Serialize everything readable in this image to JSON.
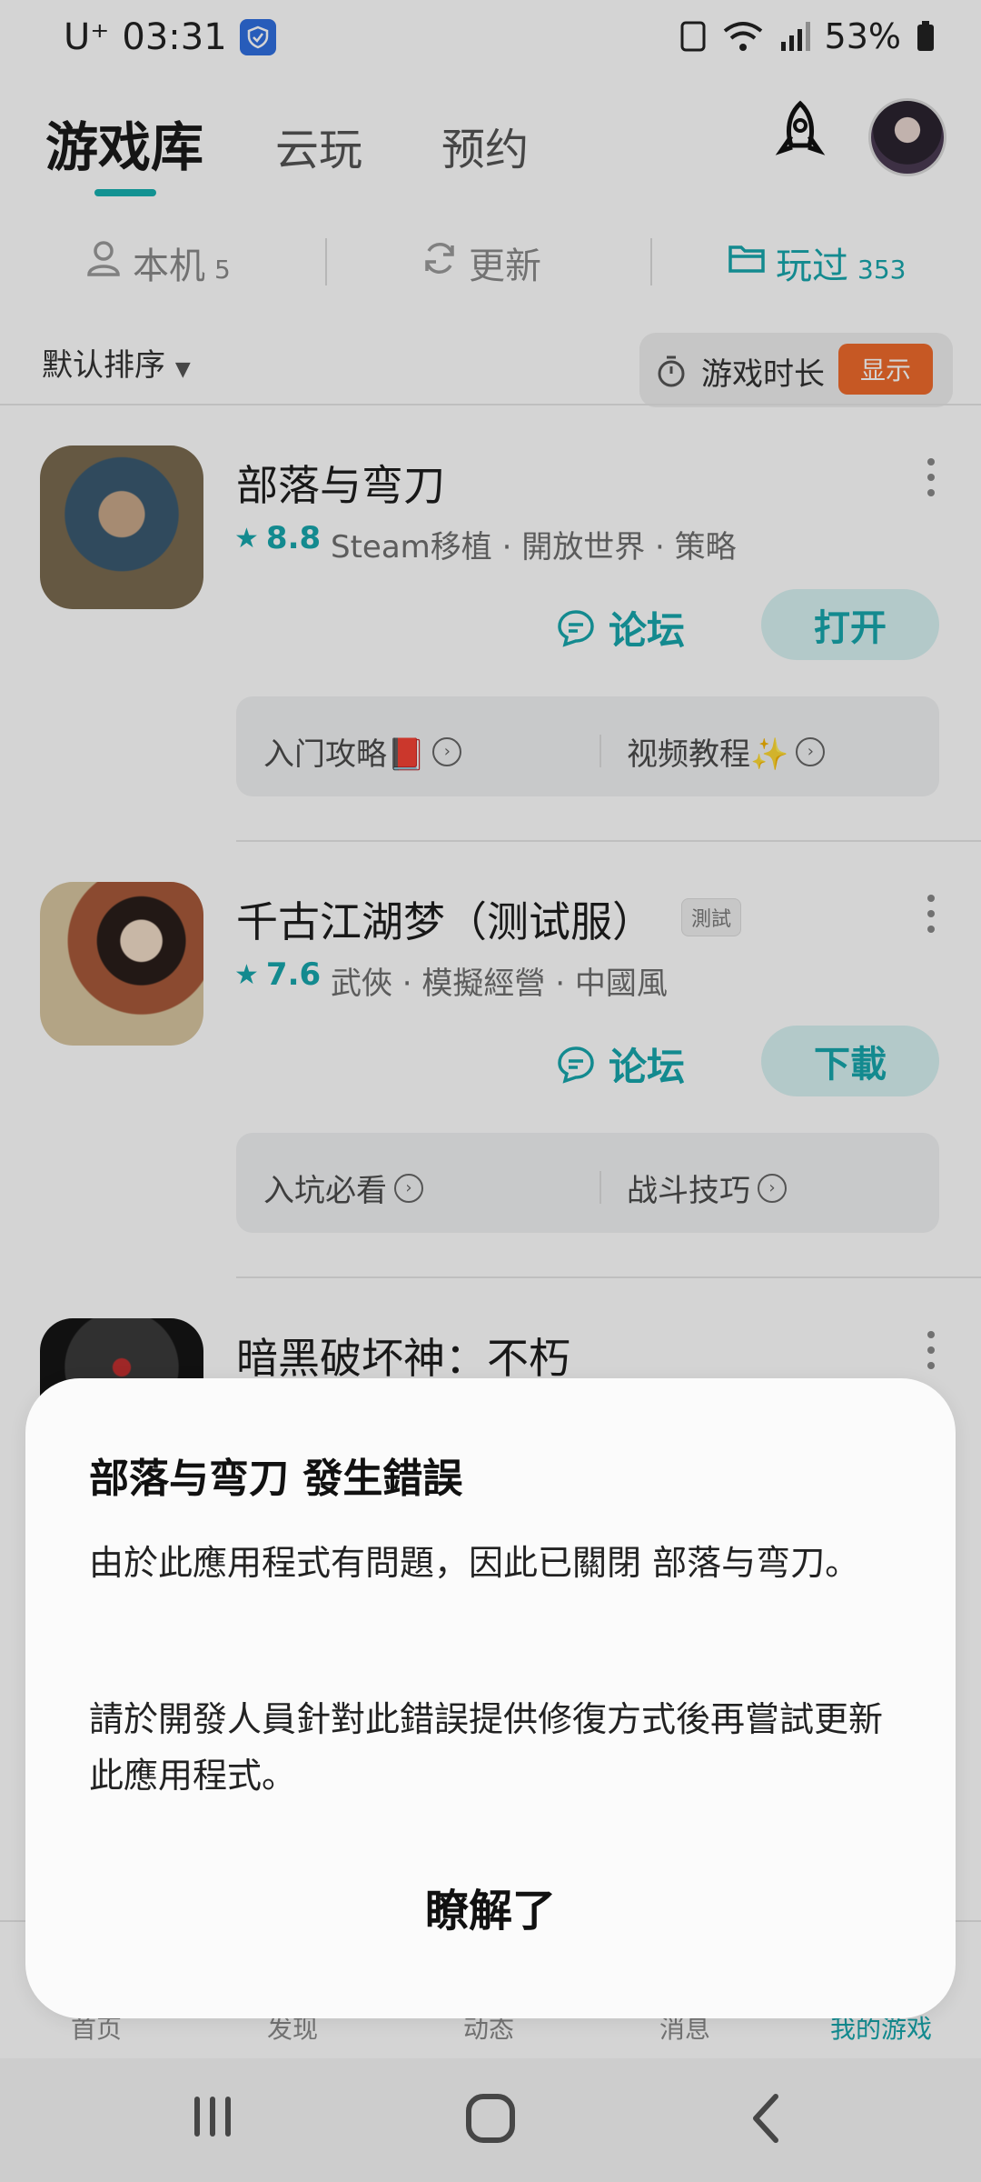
{
  "status_bar": {
    "carrier": "U⁺",
    "time": "03:31",
    "battery": "53%"
  },
  "header": {
    "tabs": [
      {
        "label": "游戏库"
      },
      {
        "label": "云玩"
      },
      {
        "label": "预约"
      }
    ]
  },
  "subnav": {
    "local_label": "本机",
    "local_count": "5",
    "update_label": "更新",
    "played_label": "玩过",
    "played_count": "353"
  },
  "sort": {
    "label": "默认排序",
    "duration_label": "游戏时长",
    "duration_badge": "显示"
  },
  "games": [
    {
      "title": "部落与弯刀",
      "rating": "8.8",
      "tags": "Steam移植 · 開放世界 · 策略",
      "forum_label": "论坛",
      "action_label": "打开",
      "guides": [
        "入门攻略📕",
        "视频教程✨"
      ]
    },
    {
      "title": "千古江湖梦（测试服）",
      "badge": "測試",
      "rating": "7.6",
      "tags": "武俠 · 模擬經營 · 中國風",
      "forum_label": "论坛",
      "action_label": "下載",
      "guides": [
        "入坑必看",
        "战斗技巧"
      ]
    },
    {
      "title": "暗黑破坏神：不朽"
    }
  ],
  "bottom_nav": [
    "首页",
    "发现",
    "动态",
    "消息",
    "我的游戏"
  ],
  "dialog": {
    "title": "部落与弯刀 發生錯誤",
    "body1": "由於此應用程式有問題，因此已關閉 部落与弯刀。",
    "body2": "請於開發人員針對此錯誤提供修復方式後再嘗試更新此應用程式。",
    "confirm": "瞭解了"
  },
  "colors": {
    "accent": "#17a6ad",
    "badge_orange": "#ee6a2c"
  }
}
